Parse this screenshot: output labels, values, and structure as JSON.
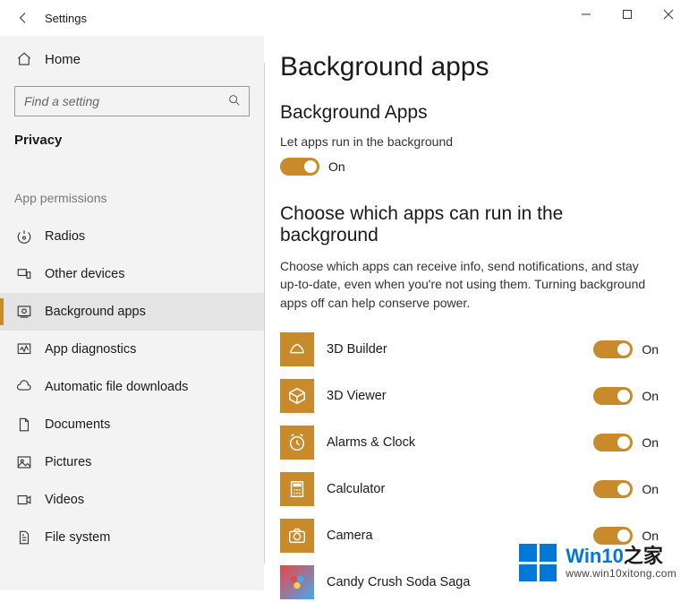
{
  "window": {
    "title": "Settings"
  },
  "sidebar": {
    "home": "Home",
    "search_placeholder": "Find a setting",
    "section": "Privacy",
    "group_label": "App permissions",
    "items": [
      {
        "icon": "radios",
        "label": "Radios",
        "selected": false
      },
      {
        "icon": "devices",
        "label": "Other devices",
        "selected": false
      },
      {
        "icon": "background",
        "label": "Background apps",
        "selected": true
      },
      {
        "icon": "diagnostics",
        "label": "App diagnostics",
        "selected": false
      },
      {
        "icon": "cloud",
        "label": "Automatic file downloads",
        "selected": false
      },
      {
        "icon": "document",
        "label": "Documents",
        "selected": false
      },
      {
        "icon": "picture",
        "label": "Pictures",
        "selected": false
      },
      {
        "icon": "video",
        "label": "Videos",
        "selected": false
      },
      {
        "icon": "filesystem",
        "label": "File system",
        "selected": false
      }
    ]
  },
  "content": {
    "title": "Background apps",
    "section1_heading": "Background Apps",
    "global_toggle_label": "Let apps run in the background",
    "global_toggle_state": "On",
    "section2_heading": "Choose which apps can run in the background",
    "description": "Choose which apps can receive info, send notifications, and stay up-to-date, even when you're not using them. Turning background apps off can help conserve power.",
    "apps": [
      {
        "name": "3D Builder",
        "state": "On",
        "icon": "builder3d"
      },
      {
        "name": "3D Viewer",
        "state": "On",
        "icon": "cube"
      },
      {
        "name": "Alarms & Clock",
        "state": "On",
        "icon": "clock"
      },
      {
        "name": "Calculator",
        "state": "On",
        "icon": "calculator"
      },
      {
        "name": "Camera",
        "state": "On",
        "icon": "camera"
      },
      {
        "name": "Candy Crush Soda Saga",
        "state": "",
        "icon": "candy"
      }
    ]
  },
  "watermark": {
    "main_pre": "Win10",
    "main_post": "之家",
    "sub": "www.win10xitong.com"
  }
}
